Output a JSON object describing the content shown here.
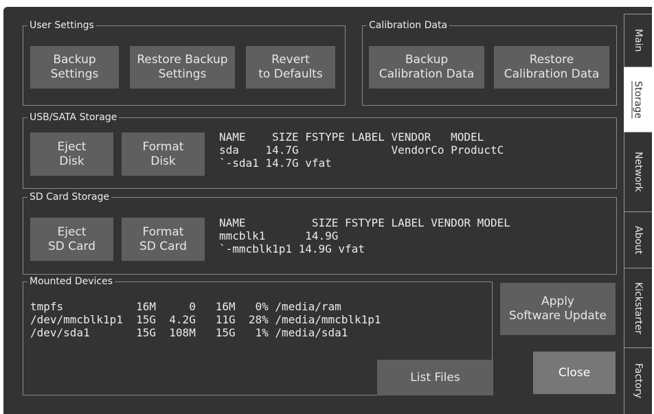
{
  "user_settings": {
    "title": "User Settings",
    "backup": "Backup\nSettings",
    "restore": "Restore Backup\nSettings",
    "revert": "Revert\nto Defaults"
  },
  "calibration": {
    "title": "Calibration Data",
    "backup": "Backup\nCalibration Data",
    "restore": "Restore\nCalibration Data"
  },
  "usb": {
    "title": "USB/SATA Storage",
    "eject": "Eject\nDisk",
    "format": "Format\nDisk",
    "listing": "NAME    SIZE FSTYPE LABEL VENDOR   MODEL\nsda    14.7G              VendorCo ProductC\n`-sda1 14.7G vfat"
  },
  "sd": {
    "title": "SD Card Storage",
    "eject": "Eject\nSD Card",
    "format": "Format\nSD Card",
    "listing": "NAME          SIZE FSTYPE LABEL VENDOR MODEL\nmmcblk1      14.9G\n`-mmcblk1p1 14.9G vfat"
  },
  "mounted": {
    "title": "Mounted Devices",
    "listing": "tmpfs           16M     0   16M   0% /media/ram\n/dev/mmcblk1p1  15G  4.2G   11G  28% /media/mmcblk1p1\n/dev/sda1       15G  108M   15G   1% /media/sda1",
    "list_files": "List Files"
  },
  "actions": {
    "apply_update": "Apply\nSoftware Update",
    "close": "Close"
  },
  "tabs": [
    "Main",
    "Storage",
    "Network",
    "About",
    "Kickstarter",
    "Factory"
  ],
  "active_tab": "Storage"
}
